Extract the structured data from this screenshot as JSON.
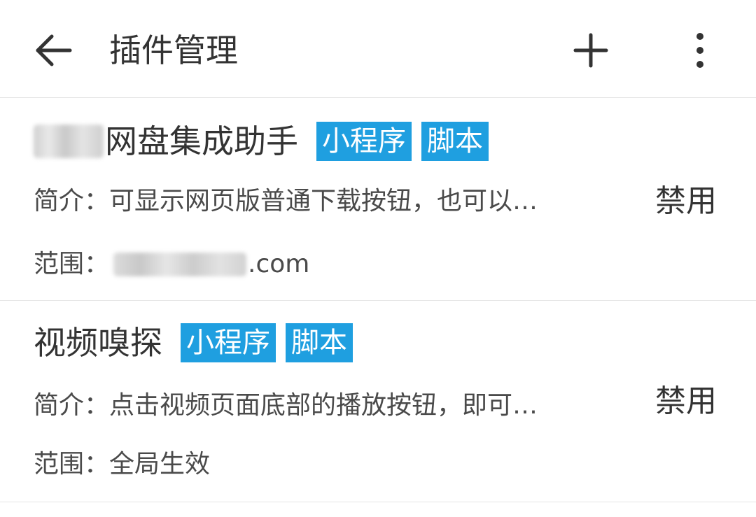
{
  "appbar": {
    "title": "插件管理",
    "back_icon": "arrow-left-icon",
    "add_icon": "plus-icon",
    "more_icon": "more-vertical-icon"
  },
  "colors": {
    "tag_bg": "#1f9fe0",
    "divider": "#e6e6e6",
    "text": "#333333"
  },
  "plugins": [
    {
      "name_visible": "网盘集成助手",
      "tags": [
        "小程序",
        "脚本"
      ],
      "intro": "简介：可显示网页版普通下载按钮，也可以…",
      "scope_label": "范围：",
      "scope_suffix": ".com",
      "action": "禁用"
    },
    {
      "name_visible": "视频嗅探",
      "tags": [
        "小程序",
        "脚本"
      ],
      "intro": "简介：点击视频页面底部的播放按钮，即可…",
      "scope_label": "范围：",
      "scope_value": "全局生效",
      "action": "禁用"
    }
  ]
}
